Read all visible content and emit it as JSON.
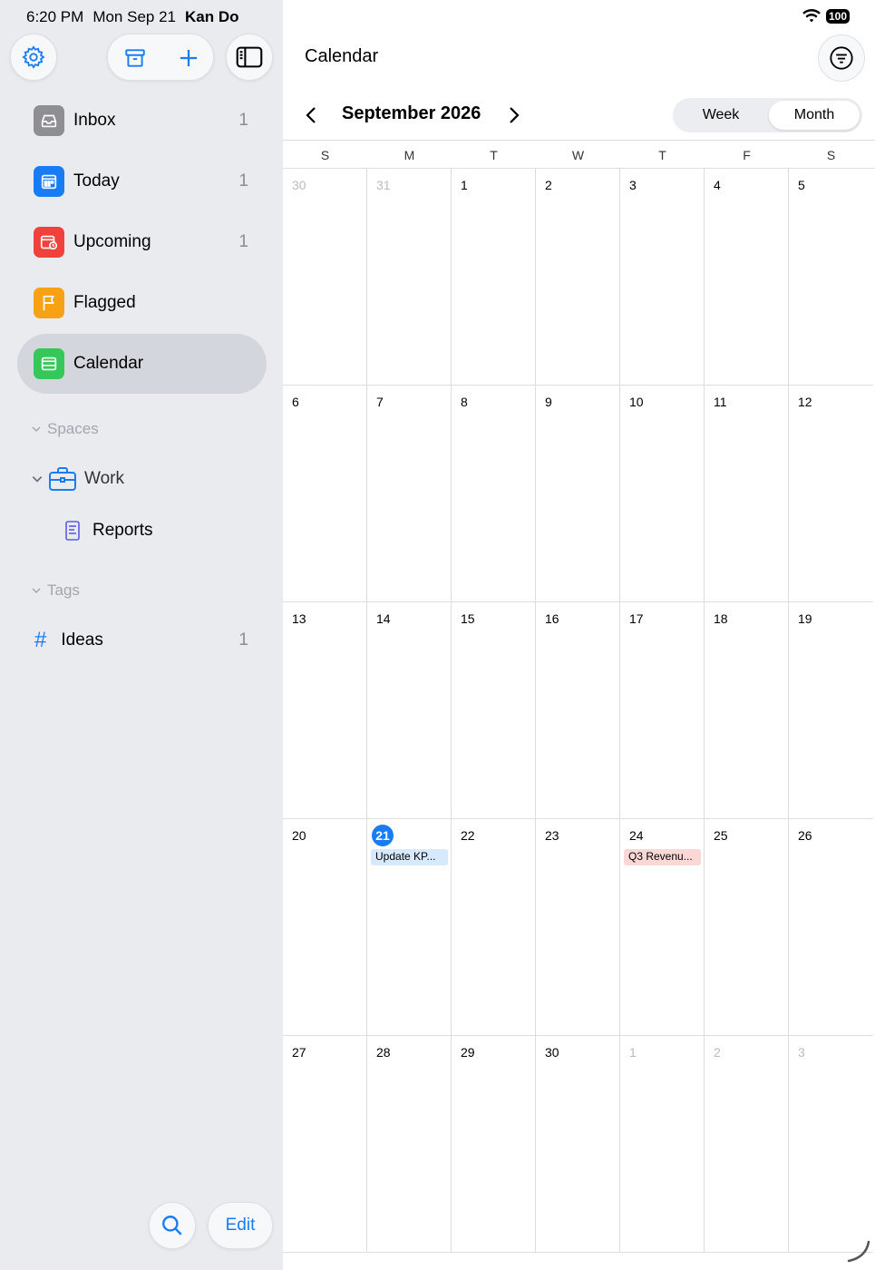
{
  "status_bar": {
    "time": "6:20 PM",
    "date": "Mon Sep 21",
    "app": "Kan Do",
    "battery": "100"
  },
  "toolbar": {
    "settings_icon": "gear-icon",
    "archive_icon": "archive-box-icon",
    "add_icon": "plus-icon",
    "sidebar_icon": "sidebar-toggle-icon"
  },
  "sidebar": {
    "items": [
      {
        "label": "Inbox",
        "count": "1",
        "icon": "inbox-icon",
        "color": "#8e8e93"
      },
      {
        "label": "Today",
        "count": "1",
        "icon": "calendar-day-icon",
        "color": "#1a7cf5"
      },
      {
        "label": "Upcoming",
        "count": "1",
        "icon": "calendar-clock-icon",
        "color": "#f0423a"
      },
      {
        "label": "Flagged",
        "count": "",
        "icon": "flag-icon",
        "color": "#f7a214"
      },
      {
        "label": "Calendar",
        "count": "",
        "icon": "calendar-list-icon",
        "color": "#35c759"
      }
    ],
    "spaces_header": "Spaces",
    "work_label": "Work",
    "reports_label": "Reports",
    "tags_header": "Tags",
    "tag_label": "Ideas",
    "tag_count": "1",
    "tag_symbol": "#",
    "edit_label": "Edit"
  },
  "main": {
    "title": "Calendar",
    "month_label": "September 2026",
    "segment": {
      "week": "Week",
      "month": "Month",
      "active": "Month"
    },
    "weekdays": [
      "S",
      "M",
      "T",
      "W",
      "T",
      "F",
      "S"
    ],
    "weeks": [
      [
        {
          "d": "30",
          "muted": true
        },
        {
          "d": "31",
          "muted": true
        },
        {
          "d": "1"
        },
        {
          "d": "2"
        },
        {
          "d": "3"
        },
        {
          "d": "4"
        },
        {
          "d": "5"
        }
      ],
      [
        {
          "d": "6"
        },
        {
          "d": "7"
        },
        {
          "d": "8"
        },
        {
          "d": "9"
        },
        {
          "d": "10"
        },
        {
          "d": "11"
        },
        {
          "d": "12"
        }
      ],
      [
        {
          "d": "13"
        },
        {
          "d": "14"
        },
        {
          "d": "15"
        },
        {
          "d": "16"
        },
        {
          "d": "17"
        },
        {
          "d": "18"
        },
        {
          "d": "19"
        }
      ],
      [
        {
          "d": "20"
        },
        {
          "d": "21",
          "today": true,
          "event": "Update KP...",
          "event_color": "blue"
        },
        {
          "d": "22"
        },
        {
          "d": "23"
        },
        {
          "d": "24",
          "event": "Q3 Revenu...",
          "event_color": "red"
        },
        {
          "d": "25"
        },
        {
          "d": "26"
        }
      ],
      [
        {
          "d": "27"
        },
        {
          "d": "28"
        },
        {
          "d": "29"
        },
        {
          "d": "30"
        },
        {
          "d": "1",
          "muted": true
        },
        {
          "d": "2",
          "muted": true
        },
        {
          "d": "3",
          "muted": true
        }
      ]
    ]
  },
  "colors": {
    "accent": "#1a7cf5",
    "sidebar_bg": "#e9ebef",
    "selected_bg": "#d3d6dc"
  }
}
